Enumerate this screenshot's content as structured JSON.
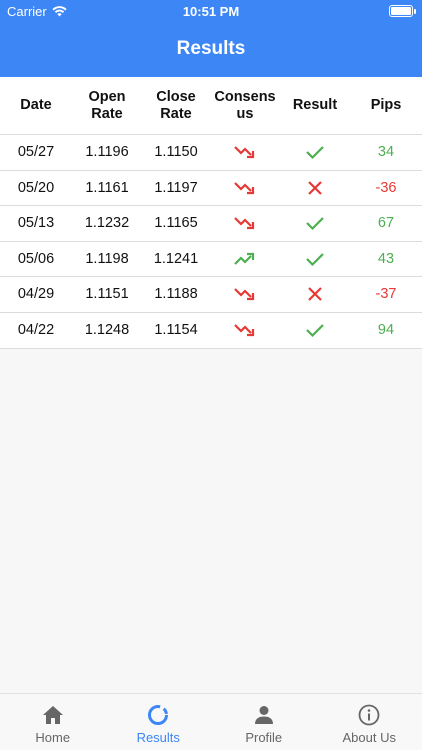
{
  "status_bar": {
    "carrier": "Carrier",
    "time": "10:51 PM"
  },
  "header": {
    "title": "Results"
  },
  "table": {
    "columns": {
      "date": "Date",
      "open": "Open Rate",
      "close": "Close Rate",
      "consensus": "Consensus",
      "result": "Result",
      "pips": "Pips"
    },
    "rows": [
      {
        "date": "05/27",
        "open": "1.1196",
        "close": "1.1150",
        "consensus": "down",
        "result": "correct",
        "pips": "34"
      },
      {
        "date": "05/20",
        "open": "1.1161",
        "close": "1.1197",
        "consensus": "down",
        "result": "wrong",
        "pips": "-36"
      },
      {
        "date": "05/13",
        "open": "1.1232",
        "close": "1.1165",
        "consensus": "down",
        "result": "correct",
        "pips": "67"
      },
      {
        "date": "05/06",
        "open": "1.1198",
        "close": "1.1241",
        "consensus": "up",
        "result": "correct",
        "pips": "43"
      },
      {
        "date": "04/29",
        "open": "1.1151",
        "close": "1.1188",
        "consensus": "down",
        "result": "wrong",
        "pips": "-37"
      },
      {
        "date": "04/22",
        "open": "1.1248",
        "close": "1.1154",
        "consensus": "down",
        "result": "correct",
        "pips": "94"
      }
    ]
  },
  "tabs": [
    {
      "label": "Home",
      "icon": "home-icon",
      "active": false
    },
    {
      "label": "Results",
      "icon": "results-icon",
      "active": true
    },
    {
      "label": "Profile",
      "icon": "profile-icon",
      "active": false
    },
    {
      "label": "About Us",
      "icon": "info-icon",
      "active": false
    }
  ],
  "colors": {
    "accent": "#3d86f5",
    "positive": "#4caf50",
    "negative": "#e53935"
  }
}
